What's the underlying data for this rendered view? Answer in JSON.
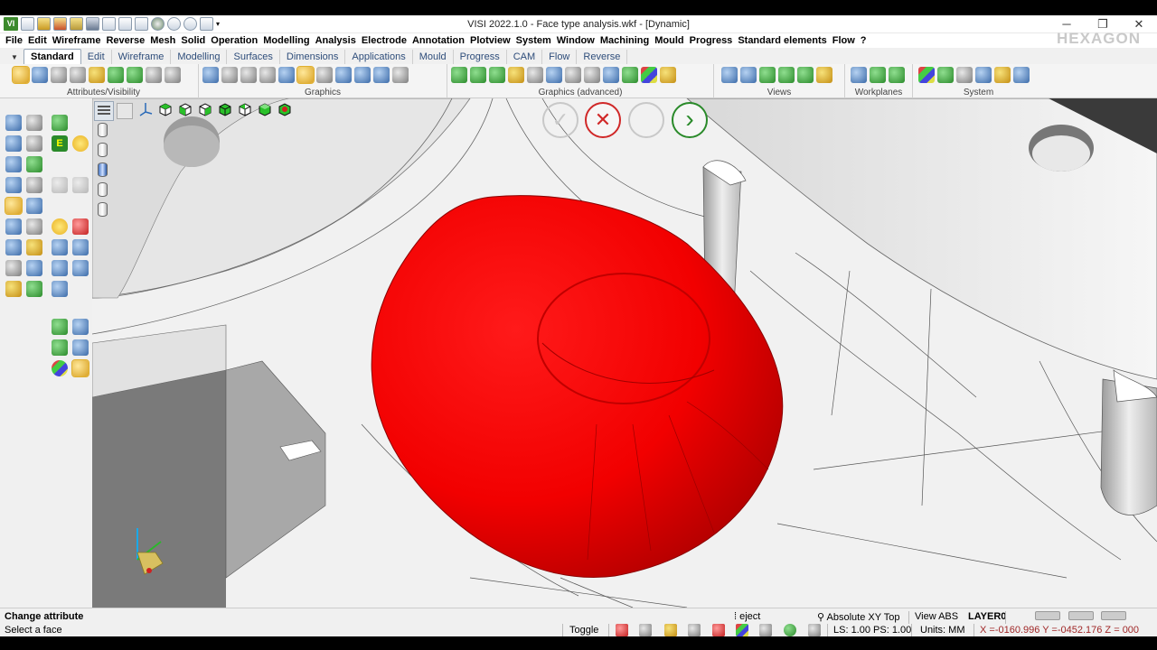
{
  "window": {
    "title": "VISI 2022.1.0 - Face type analysis.wkf - [Dynamic]",
    "app_badge": "VI",
    "minimize": "─",
    "restore": "❐",
    "close": "✕"
  },
  "brand": "HEXAGON",
  "menu": [
    "File",
    "Edit",
    "Wireframe",
    "Reverse",
    "Mesh",
    "Solid",
    "Operation",
    "Modelling",
    "Analysis",
    "Electrode",
    "Annotation",
    "Plotview",
    "System",
    "Window",
    "Machining",
    "Mould",
    "Progress",
    "Standard elements",
    "Flow",
    "?"
  ],
  "tabs": [
    "Standard",
    "Edit",
    "Wireframe",
    "Modelling",
    "Surfaces",
    "Dimensions",
    "Applications",
    "Mould",
    "Progress",
    "CAM",
    "Flow",
    "Reverse"
  ],
  "active_tab": "Standard",
  "ribbon_groups": [
    "Attributes/Visibility",
    "Graphics",
    "Graphics (advanced)",
    "Views",
    "Workplanes",
    "System"
  ],
  "confirm": {
    "cancel_glyph": "✕",
    "next_glyph": "›"
  },
  "status": {
    "command": "Change attribute",
    "prompt": "Select a face",
    "toggle": "Toggle",
    "layer_filter": "eject",
    "view_mode": "Absolute XY Top",
    "view_abs": "View ABS",
    "layer": "LAYER0",
    "ls_ps": "LS: 1.00 PS: 1.00",
    "units": "Units: MM",
    "coords": "X =-0160.996 Y =-0452.176 Z = 000"
  },
  "colors": {
    "highlight_face": "#ff0000",
    "cancel": "#d02828",
    "next": "#2a8a2a"
  }
}
